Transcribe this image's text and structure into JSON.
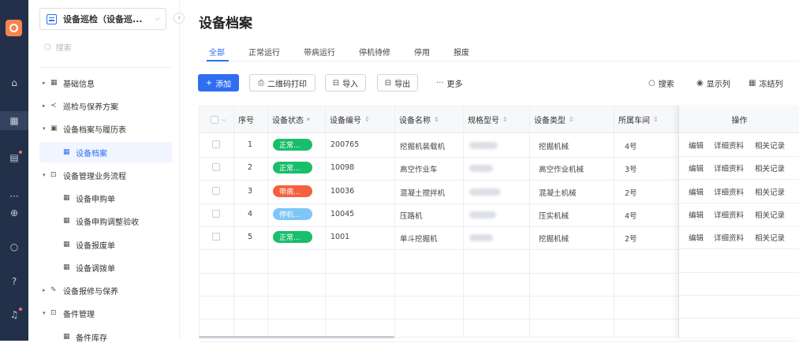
{
  "rail": {
    "icons": [
      "home-icon",
      "grid-icon",
      "clipboard-icon",
      "more-icon",
      "plus-circle-icon",
      "search-icon",
      "help-icon",
      "bell-icon"
    ]
  },
  "sidebar": {
    "app_title": "设备巡检（设备巡...",
    "search_placeholder": "搜索",
    "items": [
      {
        "label": "基础信息",
        "arrow": "▸",
        "icon": "▦"
      },
      {
        "label": "巡检与保养方案",
        "arrow": "▸",
        "icon": "≺"
      },
      {
        "label": "设备档案与履历表",
        "arrow": "▾",
        "icon": "▣"
      },
      {
        "label": "设备档案",
        "arrow": "",
        "icon": "▦"
      },
      {
        "label": "设备管理业务流程",
        "arrow": "▾",
        "icon": "⊡"
      },
      {
        "label": "设备申购单",
        "arrow": "",
        "icon": "▦"
      },
      {
        "label": "设备申购调整验收",
        "arrow": "",
        "icon": "▦"
      },
      {
        "label": "设备报废单",
        "arrow": "",
        "icon": "▦"
      },
      {
        "label": "设备调拨单",
        "arrow": "",
        "icon": "▦"
      },
      {
        "label": "设备报修与保养",
        "arrow": "▸",
        "icon": "✎"
      },
      {
        "label": "备件管理",
        "arrow": "▾",
        "icon": "⊡"
      },
      {
        "label": "备件库存",
        "arrow": "",
        "icon": "▦"
      }
    ]
  },
  "page": {
    "title": "设备档案"
  },
  "tabs": [
    "全部",
    "正常运行",
    "带病运行",
    "停机待修",
    "停用",
    "报废"
  ],
  "toolbar": {
    "add": "添加",
    "qr": "二维码打印",
    "import": "导入",
    "export": "导出",
    "more": "更多",
    "search": "搜索",
    "columns": "显示列",
    "freeze": "冻结列"
  },
  "colors": {
    "accent": "#2f6ef2",
    "normal": "#19be6b",
    "sick": "#f5603d",
    "stopped": "#7ec6f7"
  },
  "table": {
    "headers": {
      "no": "序号",
      "status": "设备状态",
      "code": "设备编号",
      "name": "设备名称",
      "model": "规格型号",
      "type": "设备类型",
      "workshop": "所属车间",
      "ops": "操作"
    },
    "rows": [
      {
        "no": "1",
        "status": "正常...",
        "status_kind": "normal",
        "code": "200765",
        "name": "挖掘机装载机",
        "type": "挖掘机械",
        "workshop": "4号"
      },
      {
        "no": "2",
        "status": "正常...",
        "status_kind": "normal",
        "code": "10098",
        "name": "高空作业车",
        "type": "高空作业机械",
        "workshop": "3号"
      },
      {
        "no": "3",
        "status": "带病...",
        "status_kind": "sick",
        "code": "10036",
        "name": "混凝土搅拌机",
        "type": "混凝土机械",
        "workshop": "2号"
      },
      {
        "no": "4",
        "status": "停机...",
        "status_kind": "stopped",
        "code": "10045",
        "name": "压路机",
        "type": "压实机械",
        "workshop": "4号"
      },
      {
        "no": "5",
        "status": "正常...",
        "status_kind": "normal",
        "code": "1001",
        "name": "单斗挖掘机",
        "type": "挖掘机械",
        "workshop": "2号"
      }
    ],
    "actions": [
      "编辑",
      "详细资料",
      "相关记录"
    ]
  }
}
